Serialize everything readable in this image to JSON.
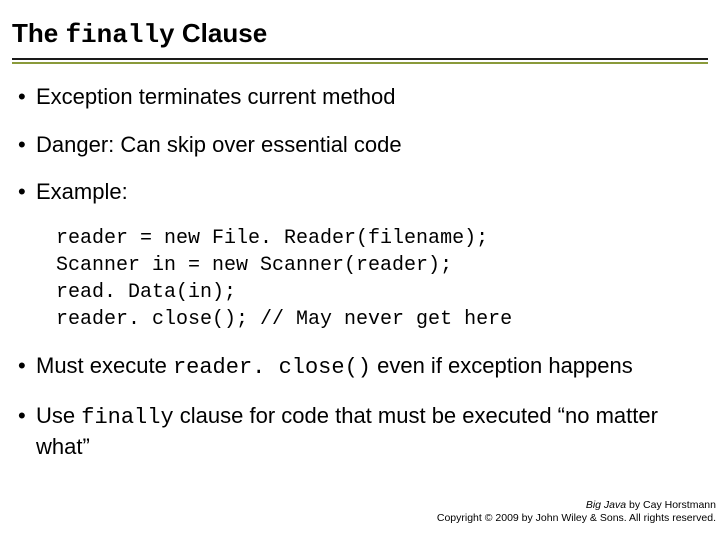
{
  "title": {
    "pre": "The ",
    "kw": "finally",
    "post": " Clause"
  },
  "bullets": {
    "b1": "Exception terminates current method",
    "b2": "Danger: Can skip over essential code",
    "b3": "Example:",
    "b4_pre": "Must execute ",
    "b4_code": "reader. close()",
    "b4_post": "  even if exception happens",
    "b5_pre": "Use ",
    "b5_code": "finally",
    "b5_post": " clause for code that must be executed “no matter what”"
  },
  "code": "reader = new File. Reader(filename);\nScanner in = new Scanner(reader);\nread. Data(in);\nreader. close(); // May never get here",
  "footer": {
    "line1_book": "Big Java",
    "line1_rest": " by Cay Horstmann",
    "line2": "Copyright © 2009 by John Wiley & Sons.  All rights reserved."
  }
}
